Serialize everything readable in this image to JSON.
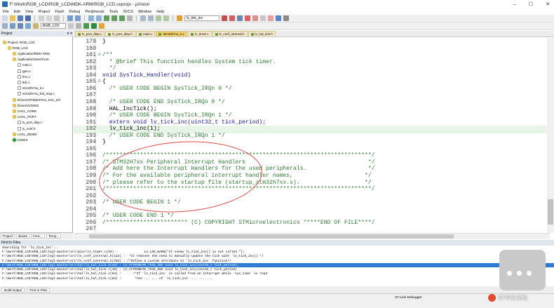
{
  "window": {
    "title": "F:\\Work\\RGB_LCD\\RGB_LCD\\MDK-ARM\\RGB_LCD.uvprojx - µVision",
    "min_glyph": "–",
    "max_glyph": "☐",
    "close_glyph": "✕"
  },
  "menu": [
    "File",
    "Edit",
    "View",
    "Project",
    "Flash",
    "Debug",
    "Peripherals",
    "Tools",
    "SVCS",
    "Window",
    "Help"
  ],
  "toolbar": {
    "find_combo": "lv_tick_inc",
    "target_combo": "RGB_LCD"
  },
  "project_panel": {
    "title": "Project",
    "pin_glyph": "▾ ✕",
    "tree": [
      {
        "label": "Project: RGB_LCD",
        "depth": 0,
        "kind": "folder"
      },
      {
        "label": "RGB_LCD",
        "depth": 1,
        "kind": "folder"
      },
      {
        "label": "Application/MDK-ARM",
        "depth": 2,
        "kind": "folder"
      },
      {
        "label": "Application/User/Core",
        "depth": 2,
        "kind": "folder"
      },
      {
        "label": "main.c",
        "depth": 3,
        "kind": "file"
      },
      {
        "label": "gpio.c",
        "depth": 3,
        "kind": "file"
      },
      {
        "label": "fmc.c",
        "depth": 3,
        "kind": "file"
      },
      {
        "label": "ltdc.c",
        "depth": 3,
        "kind": "file"
      },
      {
        "label": "stm32h7xx_it.c",
        "depth": 3,
        "kind": "file"
      },
      {
        "label": "stm32h7xx_hal_msp.c",
        "depth": 3,
        "kind": "file"
      },
      {
        "label": "Drivers/STM32H7xx_HAL_Dri",
        "depth": 2,
        "kind": "folder"
      },
      {
        "label": "Drivers/CMSIS",
        "depth": 2,
        "kind": "folder"
      },
      {
        "label": "LVGL_CORE",
        "depth": 2,
        "kind": "folder"
      },
      {
        "label": "LVGL_PORT",
        "depth": 2,
        "kind": "folder"
      },
      {
        "label": "lv_port_disp.c",
        "depth": 3,
        "kind": "file"
      },
      {
        "label": "lv_conf.h",
        "depth": 3,
        "kind": "file"
      },
      {
        "label": "LVGL_DEMO",
        "depth": 2,
        "kind": "folder"
      },
      {
        "label": "CMSIS",
        "depth": 2,
        "kind": "diamond"
      }
    ],
    "tabs": [
      "Project",
      "Books",
      "Func...",
      "Temp..."
    ]
  },
  "editor_tabs": [
    {
      "label": "lv_port_disp.c",
      "active": false
    },
    {
      "label": "lv_port_disp.h",
      "active": false
    },
    {
      "label": "main.c",
      "active": false
    },
    {
      "label": "stm32h7xx_it.c",
      "active": true
    },
    {
      "label": "lv_timer.c",
      "active": false
    },
    {
      "label": "lv_conf_internal.h",
      "active": false
    },
    {
      "label": "lv_hal_tick.h",
      "active": false
    }
  ],
  "code_lines": [
    {
      "n": "179",
      "fold": "",
      "text": "}",
      "cls": ""
    },
    {
      "n": "180",
      "fold": "",
      "text": "",
      "cls": ""
    },
    {
      "n": "181",
      "fold": "⊟",
      "text": "/**",
      "cls": "c-comment"
    },
    {
      "n": "182",
      "fold": "",
      "text": "  * @brief This function handles System tick timer.",
      "cls": "c-comment"
    },
    {
      "n": "183",
      "fold": "",
      "text": "  */",
      "cls": "c-comment"
    },
    {
      "n": "184",
      "fold": "",
      "text": "void SysTick_Handler(void)",
      "cls": "c-kw"
    },
    {
      "n": "185",
      "fold": "⊟",
      "text": "{",
      "cls": ""
    },
    {
      "n": "186",
      "fold": "",
      "text": "  /* USER CODE BEGIN SysTick_IRQn 0 */",
      "cls": "c-comment"
    },
    {
      "n": "187",
      "fold": "",
      "text": "",
      "cls": ""
    },
    {
      "n": "188",
      "fold": "",
      "text": "  /* USER CODE END SysTick_IRQn 0 */",
      "cls": "c-comment"
    },
    {
      "n": "189",
      "fold": "",
      "text": "  HAL_IncTick();",
      "cls": ""
    },
    {
      "n": "190",
      "fold": "",
      "text": "  /* USER CODE BEGIN SysTick_IRQn 1 */",
      "cls": "c-comment"
    },
    {
      "n": "191",
      "fold": "",
      "text": "  extern void lv_tick_inc(uint32_t tick_period);",
      "cls": "c-kw"
    },
    {
      "n": "192",
      "fold": "",
      "text": "  lv_tick_inc(1);",
      "cls": "hl"
    },
    {
      "n": "193",
      "fold": "",
      "text": "  /* USER CODE END SysTick_IRQn 1 */",
      "cls": "c-comment"
    },
    {
      "n": "194",
      "fold": "",
      "text": "}",
      "cls": ""
    },
    {
      "n": "195",
      "fold": "",
      "text": "",
      "cls": ""
    },
    {
      "n": "196",
      "fold": "",
      "text": "/******************************************************************************/",
      "cls": "c-comment"
    },
    {
      "n": "197",
      "fold": "",
      "text": "/* STM32H7xx Peripheral Interrupt Handlers                                    */",
      "cls": "c-comment"
    },
    {
      "n": "198",
      "fold": "",
      "text": "/* Add here the Interrupt Handlers for the used peripherals.                  */",
      "cls": "c-comment"
    },
    {
      "n": "199",
      "fold": "",
      "text": "/* For the available peripheral interrupt handler names,                     */",
      "cls": "c-comment"
    },
    {
      "n": "200",
      "fold": "",
      "text": "/* please refer to the startup file (startup_stm32h7xx.s).                   */",
      "cls": "c-comment"
    },
    {
      "n": "201",
      "fold": "",
      "text": "/******************************************************************************/",
      "cls": "c-comment"
    },
    {
      "n": "202",
      "fold": "",
      "text": "",
      "cls": ""
    },
    {
      "n": "203",
      "fold": "",
      "text": "/* USER CODE BEGIN 1 */",
      "cls": "c-comment"
    },
    {
      "n": "204",
      "fold": "",
      "text": "",
      "cls": ""
    },
    {
      "n": "205",
      "fold": "",
      "text": "/* USER CODE END 1 */",
      "cls": "c-comment"
    },
    {
      "n": "206",
      "fold": "",
      "text": "/************************ (C) COPYRIGHT STMicroelectronics *****END OF FILE****/",
      "cls": "c-comment"
    },
    {
      "n": "207",
      "fold": "",
      "text": "",
      "cls": ""
    }
  ],
  "find_panel": {
    "title": "Find In Files",
    "lines": [
      {
        "text": "Searching for 'lv_tick_inc'...",
        "sel": false
      },
      {
        "text": "F:\\Work\\RGB_LCD\\RGB_LCD\\lvgl-master\\src\\misc\\lv_timer.c(94) :              LV_LOG_WARN(\"It seems lv_tick_inc() is not called.\");",
        "sel": false
      },
      {
        "text": "F:\\Work\\RGB_LCD\\RGB_LCD\\lvgl-master\\src\\lv_conf_internal.h(122) :  *It removes the need to manually update the tick with `lv_tick_inc()`*/",
        "sel": false
      },
      {
        "text": "F:\\Work\\RGB_LCD\\RGB_LCD\\lvgl-master\\src\\lv_conf_internal.h(783) : /*Define a custom attribute to `lv_tick_inc` function*/",
        "sel": false
      },
      {
        "text": "F:\\Work\\RGB_LCD\\RGB_LCD\\lvgl-master\\src\\hal\\lv_hal_tick.h(43) : LV_ATTRIBUTE_TICK_INC void lv_tick_inc(uint32_t tick_period);",
        "sel": true
      },
      {
        "text": "F:\\Work\\RGB_LCD\\RGB_LCD\\lvgl-master\\src\\hal\\lv_hal_tick.c(48) : LV_ATTRIBUTE_TICK_INC void lv_tick_inc(uint32_t tick_period)",
        "sel": false
      },
      {
        "text": "F:\\Work\\RGB_LCD\\RGB_LCD\\lvgl-master\\src\\hal\\lv_hal_tick.c(64) :      /*If `lv_tick_inc` is called from an interrupt while `sys_time` is read",
        "sel": false
      },
      {
        "text": "F:\\Work\\RGB_LCD\\RGB_LCD\\lvgl-master\\src\\hal\\lv_hal_tick.c(83) :       *the ... ... of `lv_tick_inc` ... ... ...",
        "sel": false
      }
    ]
  },
  "bottom_tabs": [
    "Build Output",
    "Find In Files"
  ],
  "status": {
    "debugger": "ST-Link Debugger"
  },
  "watermark": {
    "text": "ST中文论坛"
  }
}
